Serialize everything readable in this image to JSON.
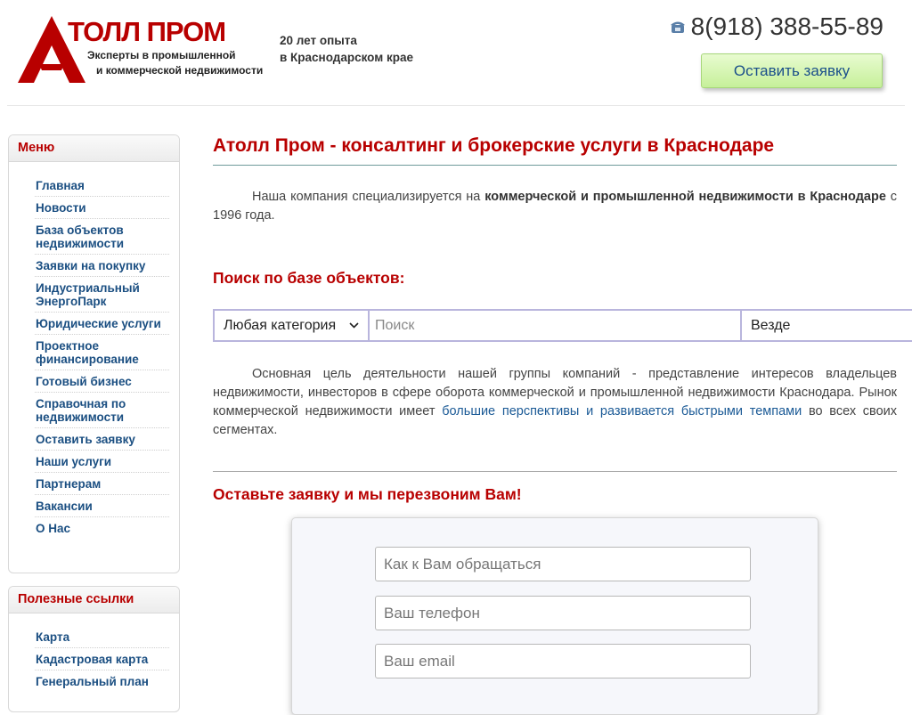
{
  "header": {
    "logo_name": "ТОЛЛ ПРОМ",
    "logo_sub_1": "Эксперты в промышленной",
    "logo_sub_2": "и коммерческой недвижимости",
    "experience_1": "20 лет опыта",
    "experience_2": "в Краснодарском крае",
    "phone": "8(918) 388-55-89",
    "cta_label": "Оставить заявку"
  },
  "sidebar": {
    "menu_title": "Меню",
    "menu_items": [
      "Главная",
      "Новости",
      "База объектов недвижимости",
      "Заявки на покупку",
      "Индустриальный ЭнергоПарк",
      "Юридические услуги",
      "Проектное финансирование",
      "Готовый бизнес",
      "Справочная по недвижимости",
      "Оставить заявку",
      "Наши услуги",
      "Партнерам",
      "Вакансии",
      "О Нас"
    ],
    "links_title": "Полезные ссылки",
    "link_items": [
      "Карта",
      "Кадастровая карта",
      "Генеральный план"
    ]
  },
  "main": {
    "title": "Атолл Пром - консалтинг и брокерские услуги в Краснодаре",
    "intro_pre": "Наша компания специализируется на ",
    "intro_bold": "коммерческой и промышленной недвижимости в Краснодаре",
    "intro_post": " с 1996 года.",
    "search_title": "Поиск по базе объектов:",
    "search": {
      "category": "Любая категория",
      "placeholder": "Поиск",
      "where": "Везде"
    },
    "purpose_pre": "Основная цель деятельности нашей группы компаний - представление интересов владельцев недвижимости, инвесторов в сфере оборота коммерческой и промышленной недвижимости Краснодара. Рынок коммерческой недвижимости имеет ",
    "purpose_link": "большие перспективы и развивается быстрыми темпами",
    "purpose_post": " во всех своих сегментах.",
    "callback_title": "Оставьте заявку и мы перезвоним Вам!",
    "form": {
      "name_placeholder": "Как к Вам обращаться",
      "phone_placeholder": "Ваш телефон",
      "email_placeholder": "Ваш email"
    }
  },
  "colors": {
    "accent_red": "#b80000",
    "link_blue": "#1b4f82",
    "cta_green": "#c6f09a"
  }
}
